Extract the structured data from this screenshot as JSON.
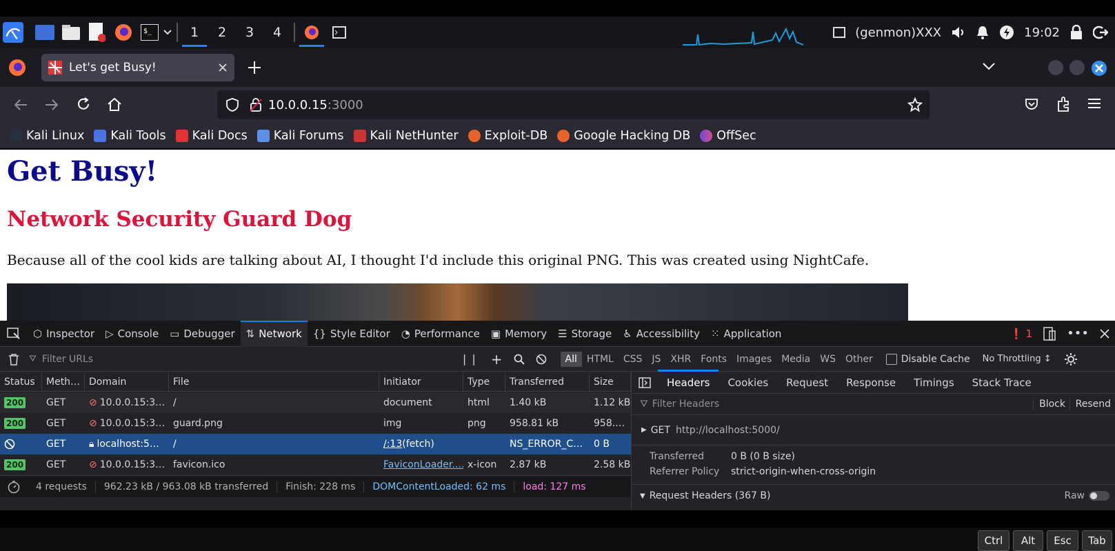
{
  "taskbar": {
    "workspaces": [
      "1",
      "2",
      "3",
      "4"
    ],
    "genmon": "(genmon)XXX",
    "clock": "19:02"
  },
  "browser": {
    "tab_title": "Let's get Busy!",
    "url_host": "10.0.0.15",
    "url_port": ":3000",
    "bookmarks": [
      "Kali Linux",
      "Kali Tools",
      "Kali Docs",
      "Kali Forums",
      "Kali NetHunter",
      "Exploit-DB",
      "Google Hacking DB",
      "OffSec"
    ]
  },
  "page": {
    "heading": "Get Busy!",
    "subheading": "Network Security Guard Dog",
    "paragraph": "Because all of the cool kids are talking about AI, I thought I'd include this original PNG. This was created using NightCafe."
  },
  "devtools": {
    "tabs": [
      "Inspector",
      "Console",
      "Debugger",
      "Network",
      "Style Editor",
      "Performance",
      "Memory",
      "Storage",
      "Accessibility",
      "Application"
    ],
    "error_count": "1",
    "filter_placeholder": "Filter URLs",
    "filter_types": [
      "All",
      "HTML",
      "CSS",
      "JS",
      "XHR",
      "Fonts",
      "Images",
      "Media",
      "WS",
      "Other"
    ],
    "disable_cache": "Disable Cache",
    "throttling": "No Throttling ↕",
    "columns": [
      "Status",
      "Meth…",
      "Domain",
      "File",
      "Initiator",
      "Type",
      "Transferred",
      "Size"
    ],
    "requests": [
      {
        "status": "200",
        "method": "GET",
        "domain": "10.0.0.15:3…",
        "file": "/",
        "initiator": "document",
        "initiator2": "",
        "type": "html",
        "transferred": "1.40 kB",
        "size": "1.12 kB"
      },
      {
        "status": "200",
        "method": "GET",
        "domain": "10.0.0.15:3…",
        "file": "guard.png",
        "initiator": "img",
        "initiator2": "",
        "type": "png",
        "transferred": "958.81 kB",
        "size": "958.…"
      },
      {
        "status": "",
        "method": "GET",
        "domain": "localhost:5…",
        "file": "/",
        "initiator": "/:13",
        "initiator2": " (fetch)",
        "type": "",
        "transferred": "NS_ERROR_C…",
        "size": "0 B"
      },
      {
        "status": "200",
        "method": "GET",
        "domain": "10.0.0.15:3…",
        "file": "favicon.ico",
        "initiator": "FaviconLoader.…",
        "initiator2": "",
        "type": "x-icon",
        "transferred": "2.87 kB",
        "size": "2.58 kB"
      }
    ],
    "summary": {
      "requests": "4 requests",
      "transferred": "962.23 kB / 963.08 kB transferred",
      "finish": "Finish: 228 ms",
      "dom": "DOMContentLoaded: 62 ms",
      "load": "load: 127 ms"
    },
    "side": {
      "tabs": [
        "Headers",
        "Cookies",
        "Request",
        "Response",
        "Timings",
        "Stack Trace"
      ],
      "filter_placeholder": "Filter Headers",
      "block": "Block",
      "resend": "Resend",
      "get_label": "GET",
      "get_url": "http://localhost:5000/",
      "transferred_key": "Transferred",
      "transferred_val": "0 B (0 B size)",
      "referrer_key": "Referrer Policy",
      "referrer_val": "strict-origin-when-cross-origin",
      "req_headers": "Request Headers (367 B)",
      "raw": "Raw"
    }
  },
  "keys": [
    "Ctrl",
    "Alt",
    "Esc",
    "Tab"
  ]
}
